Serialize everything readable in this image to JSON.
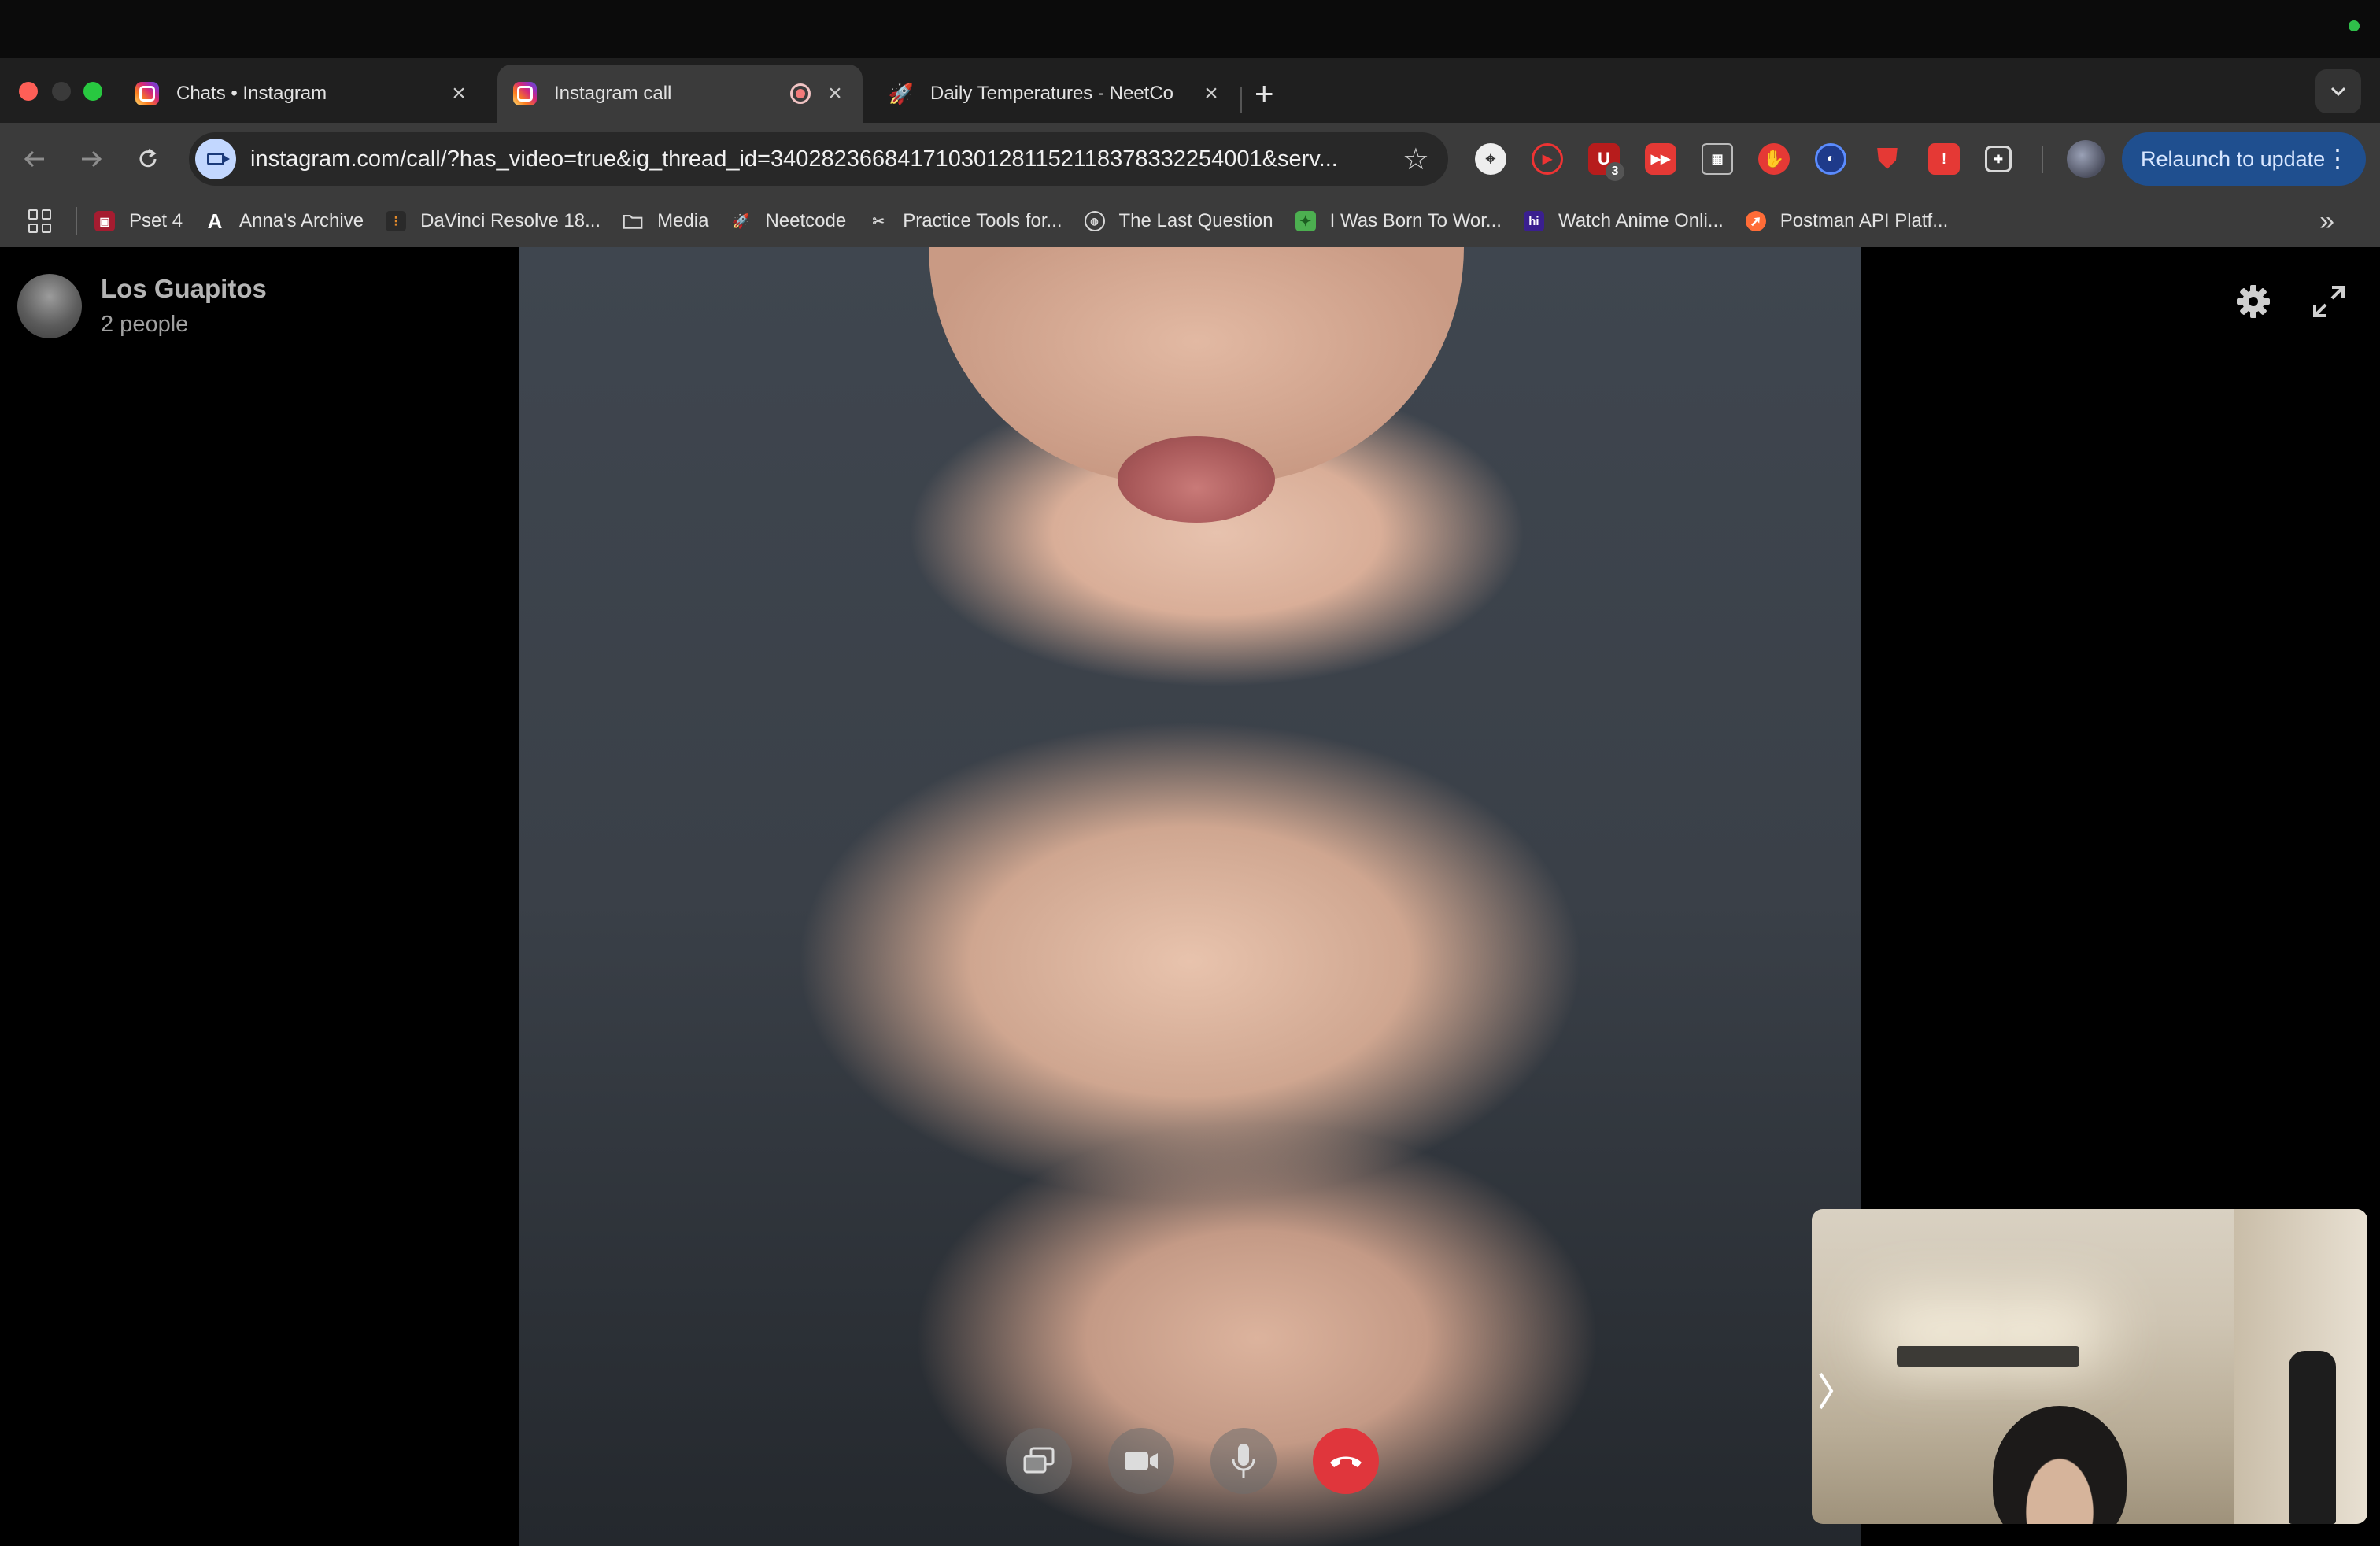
{
  "tabs": [
    {
      "title": "Chats • Instagram",
      "favicon": "instagram-icon",
      "active": false
    },
    {
      "title": "Instagram call",
      "favicon": "instagram-icon",
      "active": true,
      "recording": true
    },
    {
      "title": "Daily Temperatures - NeetCo",
      "favicon": "neetcode-rocket-icon",
      "active": false
    }
  ],
  "toolbar": {
    "url": "instagram.com/call/?has_video=true&ig_thread_id=340282366841710301281152118378332254001&serv...",
    "relaunch_label": "Relaunch to update",
    "extension_badge": "3"
  },
  "bookmarks": [
    {
      "label": "Pset 4",
      "icon": "harvard-shield-icon",
      "color": "#a51c30"
    },
    {
      "label": "Anna's Archive",
      "icon": "letter-a-icon",
      "color": "#ffffff"
    },
    {
      "label": "DaVinci Resolve 18...",
      "icon": "davinci-icon",
      "color": "#b46a1e"
    },
    {
      "label": "Media",
      "icon": "folder-icon",
      "color": "#d8d8d8"
    },
    {
      "label": "Neetcode",
      "icon": "rocket-icon",
      "color": "#ff8a3d"
    },
    {
      "label": "Practice Tools for...",
      "icon": "tools-icon",
      "color": "#d8d8d8"
    },
    {
      "label": "The Last Question",
      "icon": "globe-icon",
      "color": "#d8d8d8"
    },
    {
      "label": "I Was Born To Wor...",
      "icon": "green-puzzle-icon",
      "color": "#4caf50"
    },
    {
      "label": "Watch Anime Onli...",
      "icon": "hi-anime-icon",
      "color": "#3a1f8f"
    },
    {
      "label": "Postman API Platf...",
      "icon": "postman-icon",
      "color": "#ff6c37"
    }
  ],
  "call": {
    "group_name": "Los Guapitos",
    "participants": "2 people"
  },
  "colors": {
    "end_call": "#e0363c",
    "relaunch_bg": "#1f4f8f"
  }
}
